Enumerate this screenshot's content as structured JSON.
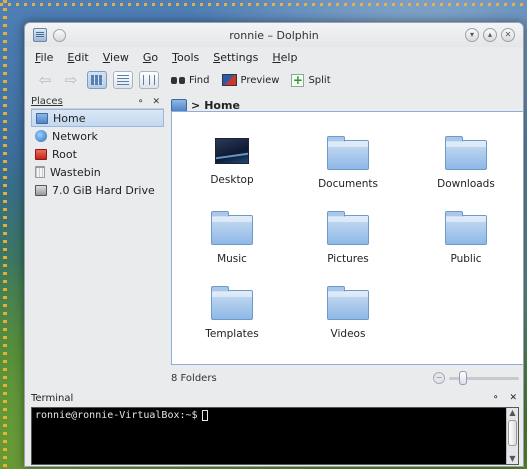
{
  "window": {
    "title": "ronnie – Dolphin"
  },
  "menu": [
    "File",
    "Edit",
    "View",
    "Go",
    "Tools",
    "Settings",
    "Help"
  ],
  "toolbar": {
    "find_label": "Find",
    "preview_label": "Preview",
    "split_label": "Split"
  },
  "places": {
    "header": "Places",
    "items": [
      {
        "label": "Home",
        "icon": "home-icon",
        "selected": true
      },
      {
        "label": "Network",
        "icon": "network-icon",
        "selected": false
      },
      {
        "label": "Root",
        "icon": "root-folder-icon",
        "selected": false
      },
      {
        "label": "Wastebin",
        "icon": "trash-icon",
        "selected": false
      },
      {
        "label": "7.0 GiB Hard Drive",
        "icon": "hard-drive-icon",
        "selected": false
      }
    ]
  },
  "breadcrumb": {
    "separator": ">",
    "current": "Home"
  },
  "files": [
    {
      "name": "Desktop",
      "icon": "desktop-icon"
    },
    {
      "name": "Documents",
      "icon": "folder-icon"
    },
    {
      "name": "Downloads",
      "icon": "folder-icon"
    },
    {
      "name": "Music",
      "icon": "folder-icon"
    },
    {
      "name": "Pictures",
      "icon": "folder-icon"
    },
    {
      "name": "Public",
      "icon": "folder-icon"
    },
    {
      "name": "Templates",
      "icon": "folder-icon"
    },
    {
      "name": "Videos",
      "icon": "folder-icon"
    }
  ],
  "status": {
    "text": "8 Folders"
  },
  "terminal": {
    "header": "Terminal",
    "prompt": "ronnie@ronnie-VirtualBox:~$"
  },
  "colors": {
    "accent": "#4f86c6",
    "selection": "#c3d8ef",
    "terminal_bg": "#000000"
  }
}
